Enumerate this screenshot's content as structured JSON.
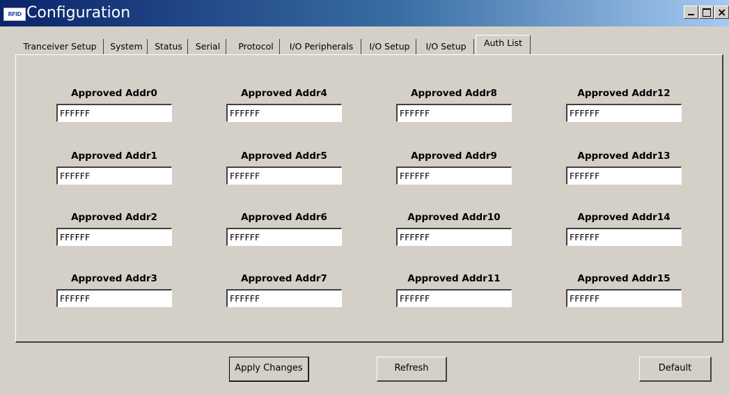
{
  "window": {
    "app_icon_text": "RFID",
    "title": "Configuration",
    "controls": {
      "minimize": "minimize",
      "maximize": "maximize",
      "close": "close"
    }
  },
  "tabs": [
    {
      "label": "Tranceiver Setup",
      "active": false
    },
    {
      "label": "System",
      "active": false
    },
    {
      "label": "Status",
      "active": false
    },
    {
      "label": "Serial",
      "active": false
    },
    {
      "label": "Protocol",
      "active": false
    },
    {
      "label": "I/O Peripherals",
      "active": false
    },
    {
      "label": "I/O Setup",
      "active": false
    },
    {
      "label": "I/O Setup",
      "active": false
    },
    {
      "label": "Auth List",
      "active": true
    }
  ],
  "fields": [
    {
      "label": "Approved Addr0",
      "value": "FFFFFF"
    },
    {
      "label": "Approved Addr1",
      "value": "FFFFFF"
    },
    {
      "label": "Approved Addr2",
      "value": "FFFFFF"
    },
    {
      "label": "Approved Addr3",
      "value": "FFFFFF"
    },
    {
      "label": "Approved Addr4",
      "value": "FFFFFF"
    },
    {
      "label": "Approved Addr5",
      "value": "FFFFFF"
    },
    {
      "label": "Approved Addr6",
      "value": "FFFFFF"
    },
    {
      "label": "Approved Addr7",
      "value": "FFFFFF"
    },
    {
      "label": "Approved Addr8",
      "value": "FFFFFF"
    },
    {
      "label": "Approved Addr9",
      "value": "FFFFFF"
    },
    {
      "label": "Approved Addr10",
      "value": "FFFFFF"
    },
    {
      "label": "Approved Addr11",
      "value": "FFFFFF"
    },
    {
      "label": "Approved Addr12",
      "value": "FFFFFF"
    },
    {
      "label": "Approved Addr13",
      "value": "FFFFFF"
    },
    {
      "label": "Approved Addr14",
      "value": "FFFFFF"
    },
    {
      "label": "Approved Addr15",
      "value": "FFFFFF"
    }
  ],
  "buttons": {
    "apply": "Apply Changes",
    "refresh": "Refresh",
    "default": "Default"
  },
  "colors": {
    "face": "#d4d0c8",
    "title_start": "#0a246a",
    "title_end": "#a6caf0"
  }
}
